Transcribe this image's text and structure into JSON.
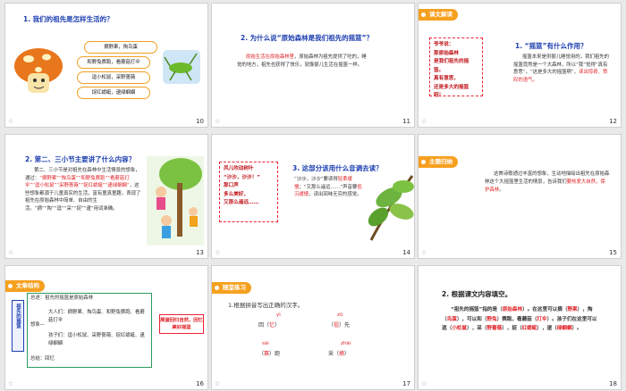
{
  "slides": [
    {
      "num": "10",
      "q": "1. 我们的祖先是怎样生活的？",
      "bubbles": [
        "摘野果，掏鸟蛋",
        "和野兔赛跑，看蘑菇打伞",
        "逗小松鼠，采野蔷薇",
        "捉红蜻蜓，逮绿蝈蝈"
      ]
    },
    {
      "num": "11",
      "q": "2. 为什么说“原始森林是我们祖先的摇篮”？",
      "p": [
        {
          "t": "原始生活在原始森林里",
          "red": true
        },
        {
          "t": "，原始森林为祖先提供了吃的，睡觉的地方，祖先也获得了快乐，就像婴儿生活在摇篮一样。",
          "red": false
        }
      ]
    },
    {
      "num": "12",
      "label": "课文解读",
      "box": [
        "爷爷说：",
        "那原始森林",
        "是我们祖先的摇篮。",
        "真有意思，",
        "还是多大的摇篮呀！"
      ],
      "q": "1. “摇篮”有什么作用？",
      "p": [
        {
          "t": "摇篮本来是供婴儿睡觉用的，我们祖先的摇篮竟然是一个大森林，所以“我”觉得“真有意思”。“这是多大的摇篮啊”，",
          "red": false
        },
        {
          "t": "读出惊奇、赞叹的语气。",
          "red": true
        }
      ]
    },
    {
      "num": "13",
      "q": "2. 第二、三小节主要讲了什么内容？",
      "p": [
        {
          "t": "第二、三小节是对祖先在森林中生活情景的想象，通过：",
          "red": false
        },
        {
          "t": "“摘野果”“掏鸟蛋”“和野兔赛跑”“看蘑菇打伞”“逗小松鼠”“采野蔷薇”“捉红蜻蜓”“逮绿蝈蝈”",
          "red": true
        },
        {
          "t": "，这些想象都源于儿童真实的生活，富有童真童趣，表现了祖先在原始森林中简单、自由的生活。“摘”“掏”“逗”“采”“捉”“逮”用词准确。",
          "red": false
        }
      ]
    },
    {
      "num": "14",
      "box": [
        "风儿吹动树叶",
        "“沙沙，沙沙！”",
        "那口声",
        "多么美好，",
        "又那么遥远……"
      ],
      "q": "3. 这部分该用什么音调去读？",
      "p": [
        {
          "t": "“沙沙，沙沙”要读得",
          "red": false
        },
        {
          "t": "轻柔缓慢",
          "red": true
        },
        {
          "t": "；“又那么遥远……”声音要",
          "red": false
        },
        {
          "t": "低沉缓慢",
          "red": true
        },
        {
          "t": "，读出回味无穷的感觉。",
          "red": false
        }
      ]
    },
    {
      "num": "15",
      "label": "主题归纳",
      "p": [
        {
          "t": "这首诗歌通过丰富的想象，生动地描绘出祖先在原始森林这个大摇篮里生活的情景，告诉我们",
          "red": false
        },
        {
          "t": "要热爱大自然，保护森林",
          "red": true
        },
        {
          "t": "。",
          "red": false
        }
      ]
    },
    {
      "num": "16",
      "label": "文章结构",
      "side": "祖先的摇篮",
      "lines": {
        "zong": "总述：祖先的摇篮是原始森林",
        "xiang": "想象—",
        "adult": "大人们：摘野果、掏鸟蛋、和野兔赛跑、看蘑菇打伞",
        "kid": "孩子们：逗小松鼠、采野蔷薇、捉红蜻蜓、逮绿蝈蝈",
        "end": "总结：回忆"
      },
      "theme": "展望回归自然，回忆美好摇篮"
    },
    {
      "num": "17",
      "label": "随堂练习",
      "inst": "1.根据拼音写出正确的汉字。",
      "items": [
        {
          "py": "yì",
          "pre": "回（",
          "ans": "忆",
          "post": "）"
        },
        {
          "py": "zǔ",
          "pre": "（",
          "ans": "祖",
          "post": "）先"
        },
        {
          "py": "sài",
          "pre": "（",
          "ans": "赛",
          "post": "）跑"
        },
        {
          "py": "zhāi",
          "pre": "采（",
          "ans": "摘",
          "post": "）"
        }
      ]
    },
    {
      "num": "18",
      "q": "2. 根据课文内容填空。",
      "fill": [
        {
          "t": "“祖先的摇篮”指的是（",
          "red": false
        },
        {
          "t": "原始森林",
          "red": true
        },
        {
          "t": "）。在这里可以摘（",
          "red": false
        },
        {
          "t": "野果",
          "red": true
        },
        {
          "t": "），掏（",
          "red": false
        },
        {
          "t": "鸟蛋",
          "red": true
        },
        {
          "t": "），可以和（",
          "red": false
        },
        {
          "t": "野兔",
          "red": true
        },
        {
          "t": "）赛跑，看蘑菇（",
          "red": false
        },
        {
          "t": "打伞",
          "red": true
        },
        {
          "t": "）。孩子们在这里可以逗（",
          "red": false
        },
        {
          "t": "小松鼠",
          "red": true
        },
        {
          "t": "），采（",
          "red": false
        },
        {
          "t": "野蔷薇",
          "red": true
        },
        {
          "t": "），捉（",
          "red": false
        },
        {
          "t": "红蜻蜓",
          "red": true
        },
        {
          "t": "），逮（",
          "red": false
        },
        {
          "t": "绿蝈蝈",
          "red": true
        },
        {
          "t": "）。",
          "red": false
        }
      ]
    }
  ],
  "slide_icon": "☆"
}
